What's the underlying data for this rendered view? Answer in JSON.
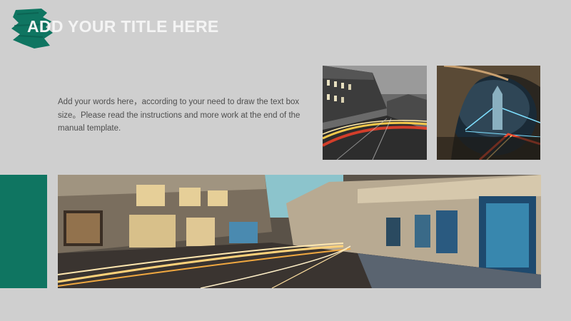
{
  "slide": {
    "title": "ADD YOUR TITLE HERE",
    "body": "Add your words here，according to your need to draw the text box size。Please read the instructions and more work at the end of the manual template."
  },
  "colors": {
    "accent": "#0f7561",
    "background": "#cfcfcf",
    "title_text": "#f4f4f4",
    "body_text": "#4e4e4e"
  }
}
